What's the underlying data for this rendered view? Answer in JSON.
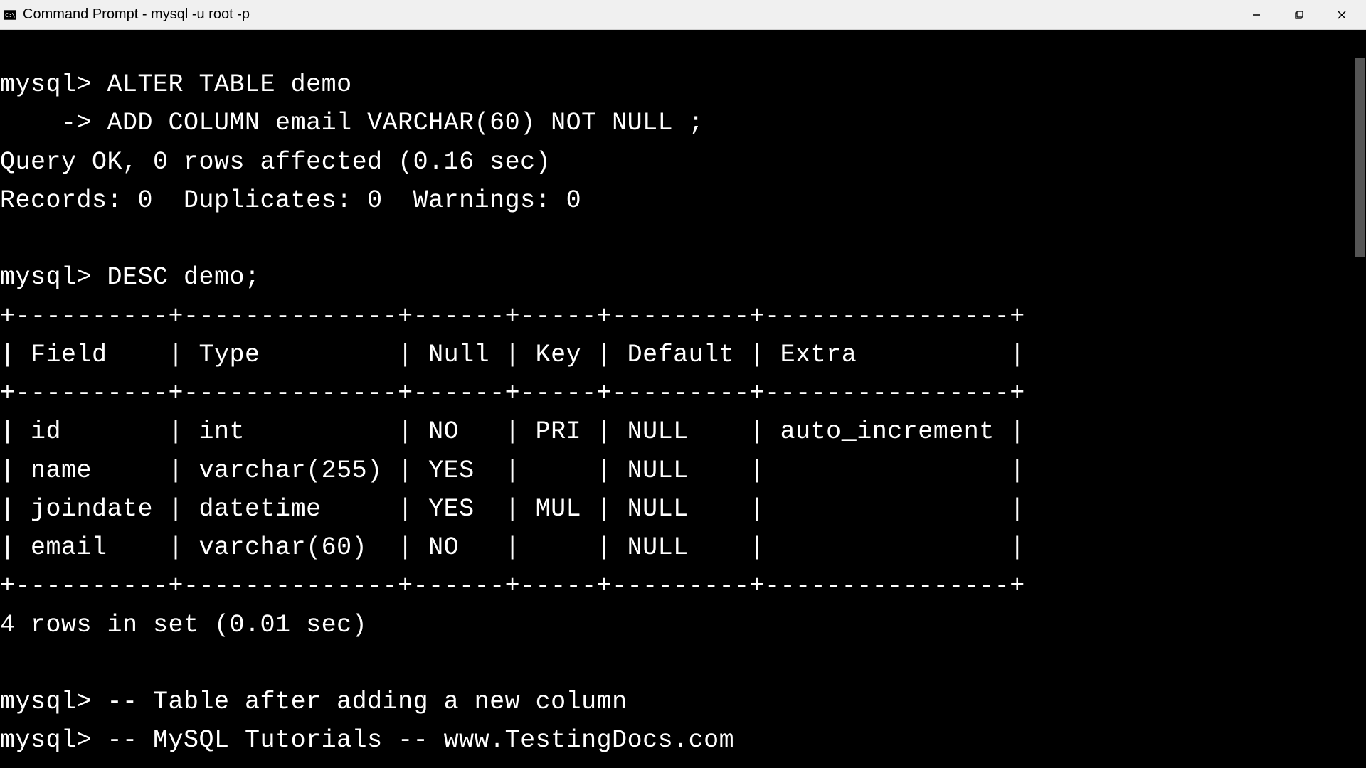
{
  "window": {
    "title": "Command Prompt - mysql  -u root -p"
  },
  "terminal": {
    "line1": "mysql> ALTER TABLE demo",
    "line2": "    -> ADD COLUMN email VARCHAR(60) NOT NULL ;",
    "line3": "Query OK, 0 rows affected (0.16 sec)",
    "line4": "Records: 0  Duplicates: 0  Warnings: 0",
    "line5": "",
    "line6": "mysql> DESC demo;",
    "border1": "+----------+--------------+------+-----+---------+----------------+",
    "header": "| Field    | Type         | Null | Key | Default | Extra          |",
    "border2": "+----------+--------------+------+-----+---------+----------------+",
    "row1": "| id       | int          | NO   | PRI | NULL    | auto_increment |",
    "row2": "| name     | varchar(255) | YES  |     | NULL    |                |",
    "row3": "| joindate | datetime     | YES  | MUL | NULL    |                |",
    "row4": "| email    | varchar(60)  | NO   |     | NULL    |                |",
    "border3": "+----------+--------------+------+-----+---------+----------------+",
    "line7": "4 rows in set (0.01 sec)",
    "line8": "",
    "line9": "mysql> -- Table after adding a new column",
    "line10": "mysql> -- MySQL Tutorials -- www.TestingDocs.com"
  },
  "table_data": {
    "headers": [
      "Field",
      "Type",
      "Null",
      "Key",
      "Default",
      "Extra"
    ],
    "rows": [
      {
        "Field": "id",
        "Type": "int",
        "Null": "NO",
        "Key": "PRI",
        "Default": "NULL",
        "Extra": "auto_increment"
      },
      {
        "Field": "name",
        "Type": "varchar(255)",
        "Null": "YES",
        "Key": "",
        "Default": "NULL",
        "Extra": ""
      },
      {
        "Field": "joindate",
        "Type": "datetime",
        "Null": "YES",
        "Key": "MUL",
        "Default": "NULL",
        "Extra": ""
      },
      {
        "Field": "email",
        "Type": "varchar(60)",
        "Null": "NO",
        "Key": "",
        "Default": "NULL",
        "Extra": ""
      }
    ],
    "summary": "4 rows in set (0.01 sec)"
  }
}
